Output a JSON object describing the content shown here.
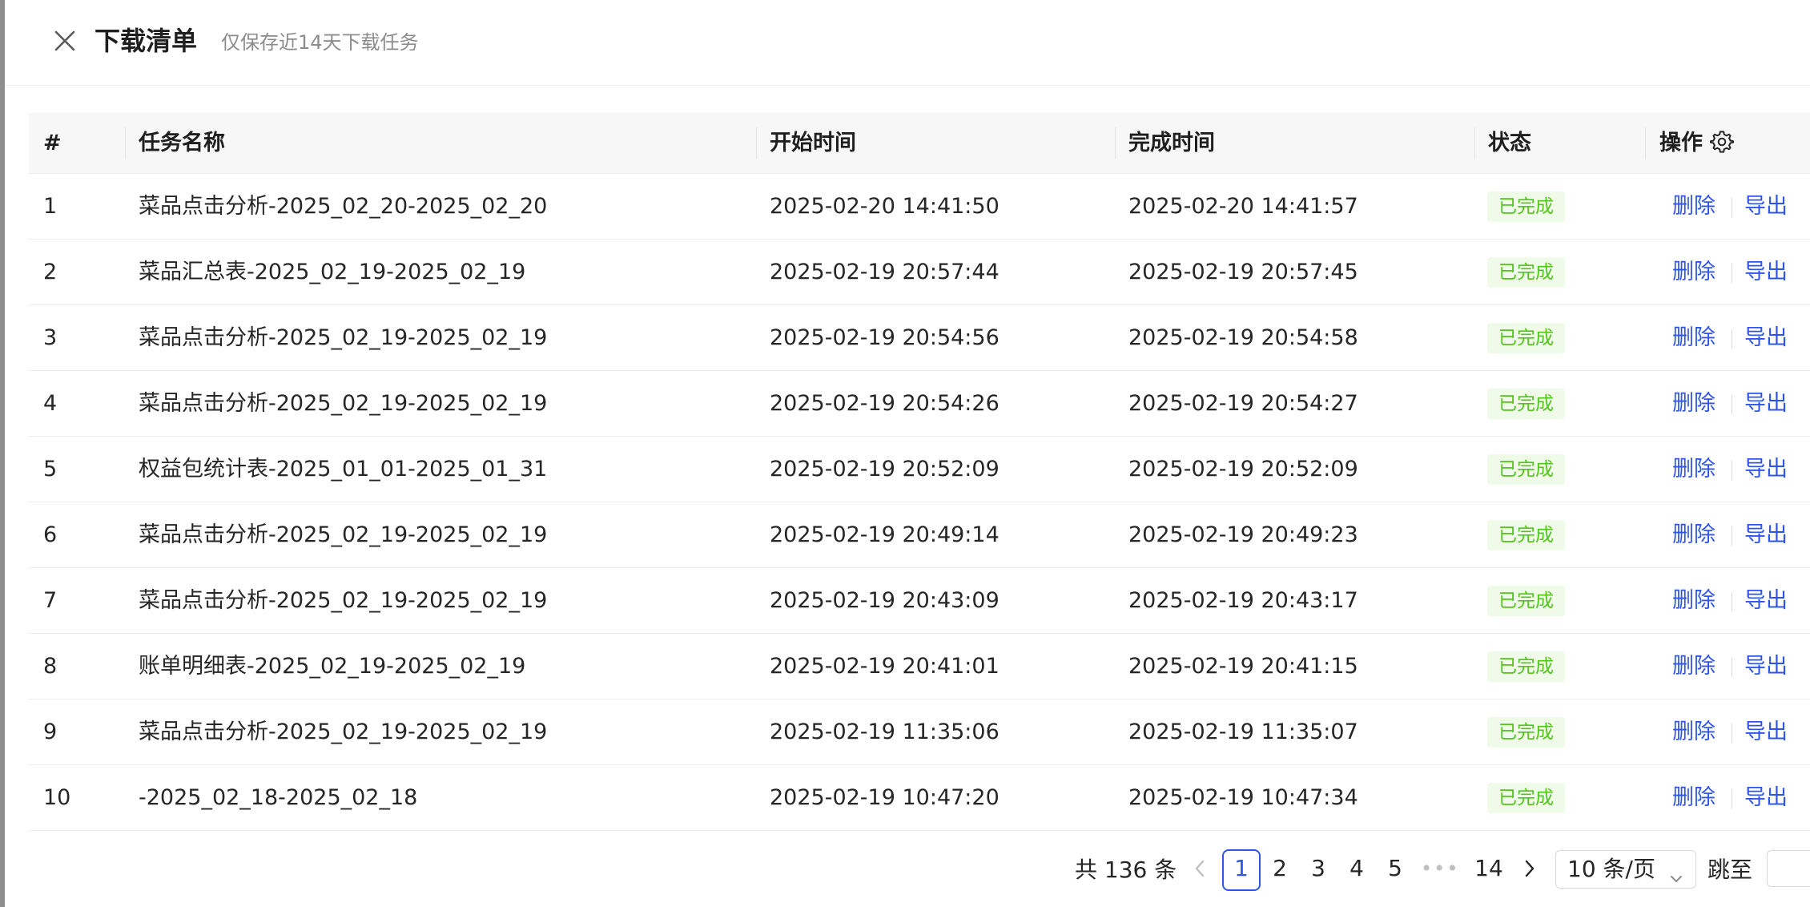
{
  "drawer": {
    "title": "下载清单",
    "subtitle": "仅保存近14天下载任务"
  },
  "table": {
    "columns": [
      "#",
      "任务名称",
      "开始时间",
      "完成时间",
      "状态",
      "操作"
    ],
    "rows": [
      {
        "no": "1",
        "name": "菜品点击分析-2025_02_20-2025_02_20",
        "start": "2025-02-20 14:41:50",
        "end": "2025-02-20 14:41:57",
        "status": "已完成",
        "del": "删除",
        "export": "导出"
      },
      {
        "no": "2",
        "name": "菜品汇总表-2025_02_19-2025_02_19",
        "start": "2025-02-19 20:57:44",
        "end": "2025-02-19 20:57:45",
        "status": "已完成",
        "del": "删除",
        "export": "导出"
      },
      {
        "no": "3",
        "name": "菜品点击分析-2025_02_19-2025_02_19",
        "start": "2025-02-19 20:54:56",
        "end": "2025-02-19 20:54:58",
        "status": "已完成",
        "del": "删除",
        "export": "导出"
      },
      {
        "no": "4",
        "name": "菜品点击分析-2025_02_19-2025_02_19",
        "start": "2025-02-19 20:54:26",
        "end": "2025-02-19 20:54:27",
        "status": "已完成",
        "del": "删除",
        "export": "导出"
      },
      {
        "no": "5",
        "name": "权益包统计表-2025_01_01-2025_01_31",
        "start": "2025-02-19 20:52:09",
        "end": "2025-02-19 20:52:09",
        "status": "已完成",
        "del": "删除",
        "export": "导出"
      },
      {
        "no": "6",
        "name": "菜品点击分析-2025_02_19-2025_02_19",
        "start": "2025-02-19 20:49:14",
        "end": "2025-02-19 20:49:23",
        "status": "已完成",
        "del": "删除",
        "export": "导出"
      },
      {
        "no": "7",
        "name": "菜品点击分析-2025_02_19-2025_02_19",
        "start": "2025-02-19 20:43:09",
        "end": "2025-02-19 20:43:17",
        "status": "已完成",
        "del": "删除",
        "export": "导出"
      },
      {
        "no": "8",
        "name": "账单明细表-2025_02_19-2025_02_19",
        "start": "2025-02-19 20:41:01",
        "end": "2025-02-19 20:41:15",
        "status": "已完成",
        "del": "删除",
        "export": "导出"
      },
      {
        "no": "9",
        "name": "菜品点击分析-2025_02_19-2025_02_19",
        "start": "2025-02-19 11:35:06",
        "end": "2025-02-19 11:35:07",
        "status": "已完成",
        "del": "删除",
        "export": "导出"
      },
      {
        "no": "10",
        "name": "-2025_02_18-2025_02_18",
        "start": "2025-02-19 10:47:20",
        "end": "2025-02-19 10:47:34",
        "status": "已完成",
        "del": "删除",
        "export": "导出"
      }
    ]
  },
  "pagination": {
    "total_text": "共 136 条",
    "pages": [
      "1",
      "2",
      "3",
      "4",
      "5"
    ],
    "current_page": "1",
    "ellipsis": "•••",
    "last_page": "14",
    "page_size": "10 条/页",
    "jump_label": "跳至",
    "jump_value": ""
  },
  "colors": {
    "accent": "#2f54eb",
    "status_success": "#52c41a",
    "status_success_bg": "#effbe8",
    "header_bg": "#f7f7f8"
  },
  "icons": {
    "close": "close-icon",
    "settings": "gear-icon",
    "prev": "chevron-left-icon",
    "next": "chevron-right-icon",
    "dropdown": "chevron-down-icon"
  }
}
